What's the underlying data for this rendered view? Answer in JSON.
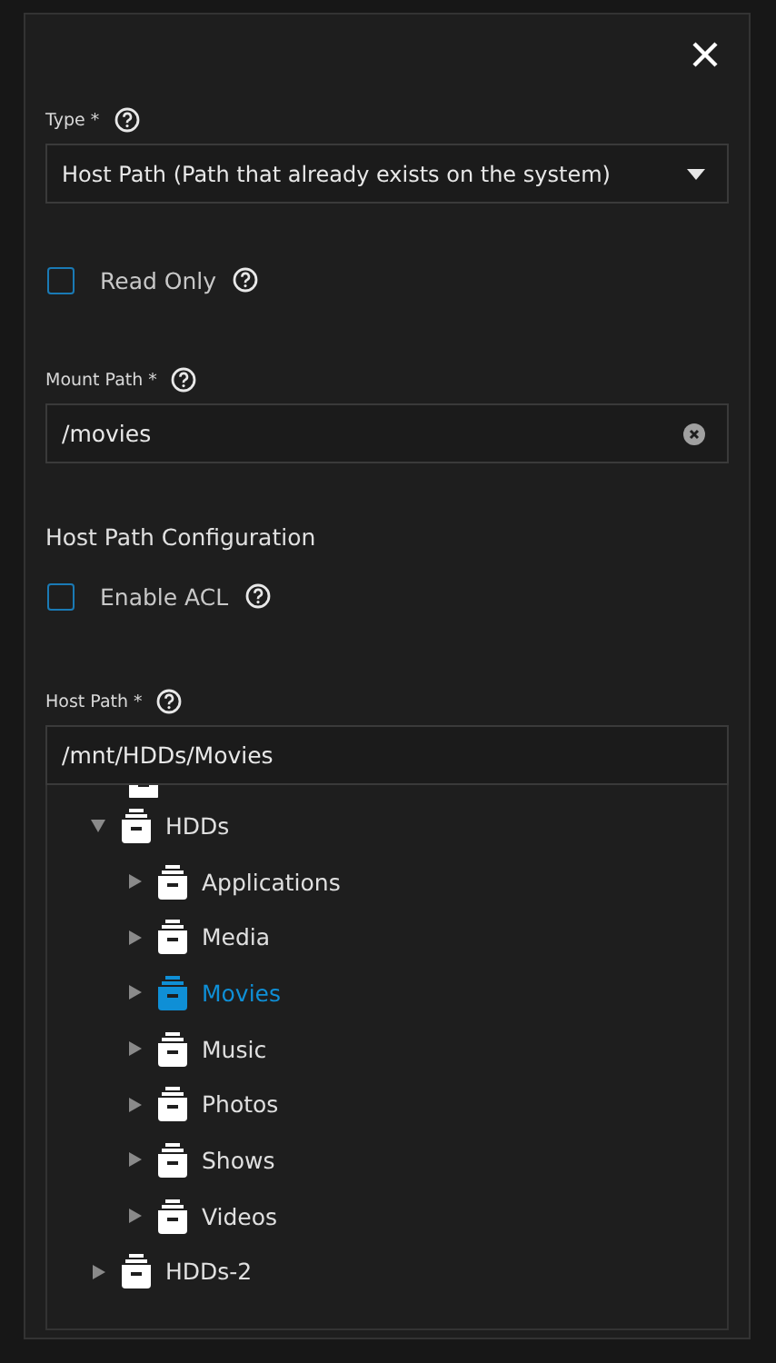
{
  "type_field": {
    "label": "Type *",
    "value": "Host Path (Path that already exists on the system)"
  },
  "read_only": {
    "label": "Read Only",
    "checked": false
  },
  "mount_path": {
    "label": "Mount Path *",
    "value": "/movies"
  },
  "section_title": "Host Path Configuration",
  "enable_acl": {
    "label": "Enable ACL",
    "checked": false
  },
  "host_path": {
    "label": "Host Path *",
    "value": "/mnt/HDDs/Movies"
  },
  "tree": [
    {
      "name": "HDDs",
      "expanded": true,
      "selected": false,
      "children": [
        {
          "name": "Applications",
          "expanded": false,
          "selected": false
        },
        {
          "name": "Media",
          "expanded": false,
          "selected": false
        },
        {
          "name": "Movies",
          "expanded": false,
          "selected": true
        },
        {
          "name": "Music",
          "expanded": false,
          "selected": false
        },
        {
          "name": "Photos",
          "expanded": false,
          "selected": false
        },
        {
          "name": "Shows",
          "expanded": false,
          "selected": false
        },
        {
          "name": "Videos",
          "expanded": false,
          "selected": false
        }
      ]
    },
    {
      "name": "HDDs-2",
      "expanded": false,
      "selected": false
    }
  ]
}
